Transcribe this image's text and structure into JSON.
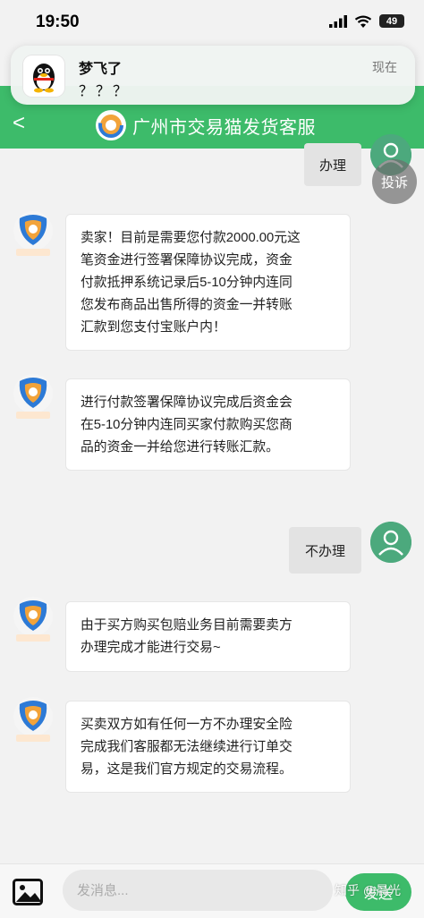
{
  "status_bar": {
    "time": "19:50",
    "battery": "49"
  },
  "notification": {
    "sender": "梦飞了",
    "message": "？？？",
    "time": "现在"
  },
  "header": {
    "back": "<",
    "title": "广州市交易猫发货客服"
  },
  "complaint_label": "投诉",
  "messages": [
    {
      "side": "right",
      "text": "办理"
    },
    {
      "side": "left",
      "lines": [
        "卖家！目前是需要您付款2000.00元这",
        "笔资金进行签署保障协议完成，资金",
        "付款抵押系统记录后5-10分钟内连同",
        "您发布商品出售所得的资金一并转账",
        "汇款到您支付宝账户内！"
      ]
    },
    {
      "side": "left",
      "lines": [
        "进行付款签署保障协议完成后资金会",
        "在5-10分钟内连同买家付款购买您商",
        "品的资金一并给您进行转账汇款。"
      ]
    },
    {
      "side": "right",
      "text": "不办理"
    },
    {
      "side": "left",
      "lines": [
        "由于买方购买包赔业务目前需要卖方",
        "办理完成才能进行交易~"
      ]
    },
    {
      "side": "left",
      "lines": [
        "买卖双方如有任何一方不办理安全险",
        "完成我们客服都无法继续进行订单交",
        "易，这是我们官方规定的交易流程。"
      ]
    }
  ],
  "composer": {
    "placeholder": "发消息...",
    "send": "发送"
  },
  "watermark": "知乎 @晨光",
  "colors": {
    "brand_green": "#3dbb6a",
    "user_avatar": "#4ca97d",
    "bubble_right": "#e3e3e3"
  },
  "icons": [
    "signal-icon",
    "wifi-icon",
    "battery-icon",
    "qq-penguin-icon",
    "back-arrow-icon",
    "jiaoyimao-logo-icon",
    "user-avatar-icon",
    "agent-avatar-icon",
    "image-icon"
  ]
}
